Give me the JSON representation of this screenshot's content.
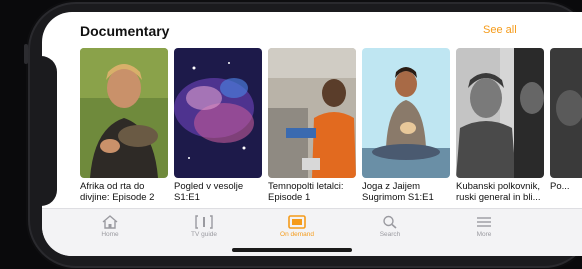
{
  "header": {
    "title": "Documentary",
    "see_all": "See all"
  },
  "cards": [
    {
      "caption": "Afrika od rta do divjine: Episode 2"
    },
    {
      "caption": "Pogled v vesolje S1:E1"
    },
    {
      "caption": "Temnopolti letalci: Episode 1"
    },
    {
      "caption": "Joga z Jaijem Sugrimom S1:E1"
    },
    {
      "caption": "Kubanski polkovnik, ruski general in bli..."
    },
    {
      "caption": "Po..."
    }
  ],
  "tabbar": {
    "tabs": [
      {
        "label": "Home",
        "icon": "house-icon"
      },
      {
        "label": "TV guide",
        "icon": "tv-guide-icon"
      },
      {
        "label": "On demand",
        "icon": "on-demand-icon",
        "active": true
      },
      {
        "label": "Search",
        "icon": "search-icon"
      },
      {
        "label": "More",
        "icon": "menu-icon"
      }
    ]
  },
  "colors": {
    "accent": "#f59b1a"
  }
}
